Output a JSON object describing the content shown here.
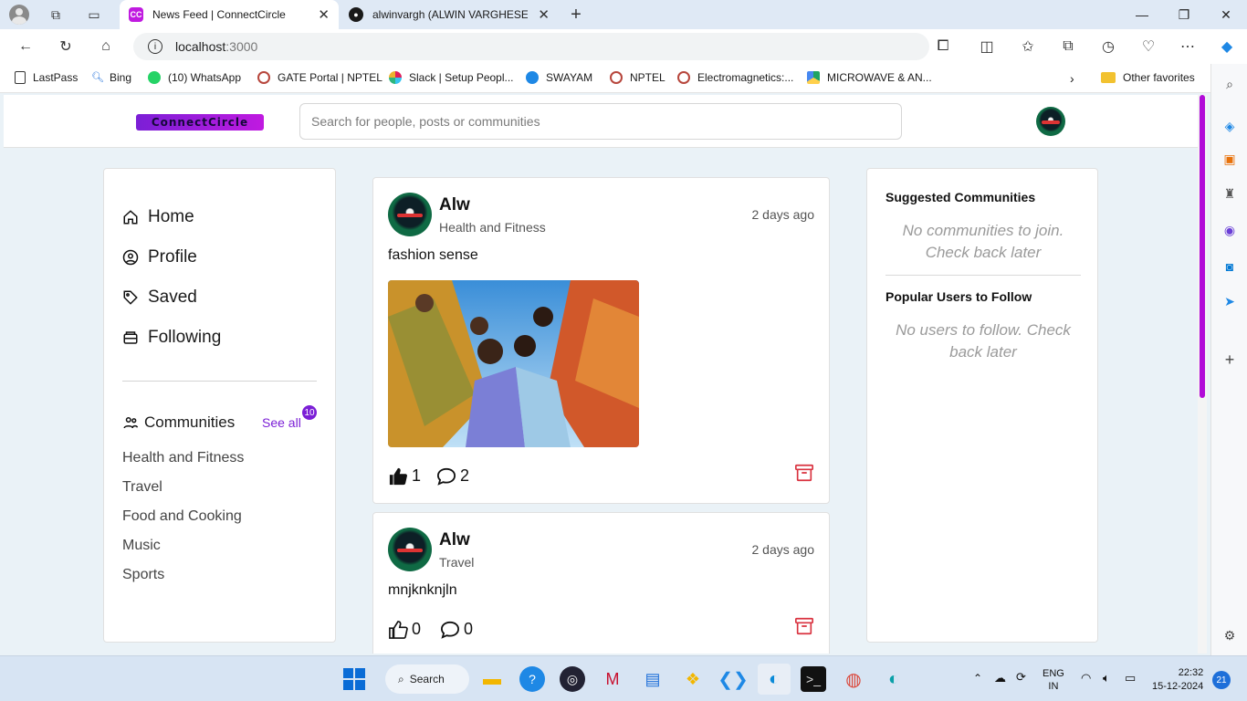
{
  "browser": {
    "tabs": [
      {
        "title": "News Feed | ConnectCircle",
        "favicon": "CC",
        "active": true
      },
      {
        "title": "alwinvargh (ALWIN VARGHESE) ·",
        "favicon": "github",
        "active": false
      }
    ],
    "address": {
      "host": "localhost",
      "port": ":3000"
    },
    "bookmarks": [
      {
        "label": "LastPass",
        "color": "#444444"
      },
      {
        "label": "Bing",
        "color": "#1e6fd9"
      },
      {
        "label": "(10) WhatsApp",
        "color": "#25d366"
      },
      {
        "label": "GATE Portal | NPTEL",
        "color": "#b7463c"
      },
      {
        "label": "Slack | Setup Peopl...",
        "color": "#e01e5a"
      },
      {
        "label": "SWAYAM",
        "color": "#1e88e5"
      },
      {
        "label": "NPTEL",
        "color": "#b7463c"
      },
      {
        "label": "Electromagnetics:...",
        "color": "#b7463c"
      },
      {
        "label": "MICROWAVE & AN...",
        "color": "#1fa463"
      }
    ],
    "other_favorites": "Other favorites",
    "notification_count": "1"
  },
  "header": {
    "logo_text": "ConnectCircle",
    "search_placeholder": "Search for people, posts or communities"
  },
  "nav": {
    "items": [
      {
        "label": "Home",
        "icon": "home-icon"
      },
      {
        "label": "Profile",
        "icon": "user-circle-icon"
      },
      {
        "label": "Saved",
        "icon": "tag-icon"
      },
      {
        "label": "Following",
        "icon": "inbox-icon"
      }
    ],
    "communities_heading": "Communities",
    "see_all": "See all",
    "communities_count": "10",
    "communities": [
      "Health and Fitness",
      "Travel",
      "Food and Cooking",
      "Music",
      "Sports"
    ]
  },
  "posts": [
    {
      "author": "Alw",
      "community": "Health and Fitness",
      "time": "2 days ago",
      "body": "fashion sense",
      "likes": "1",
      "comments": "2",
      "liked": true,
      "has_image": true
    },
    {
      "author": "Alw",
      "community": "Travel",
      "time": "2 days ago",
      "body": "mnjknknjln",
      "likes": "0",
      "comments": "0",
      "liked": false,
      "has_image": false
    }
  ],
  "right": {
    "suggested_title": "Suggested Communities",
    "suggested_empty": "No communities to join. Check back later",
    "popular_title": "Popular Users to Follow",
    "popular_empty": "No users to follow. Check back later"
  },
  "taskbar": {
    "search_label": "Search",
    "lang_line1": "ENG",
    "lang_line2": "IN",
    "time": "22:32",
    "date": "15-12-2024",
    "notifications": "21"
  },
  "colors": {
    "accent": "#7b1fd6",
    "danger": "#d9323f"
  }
}
